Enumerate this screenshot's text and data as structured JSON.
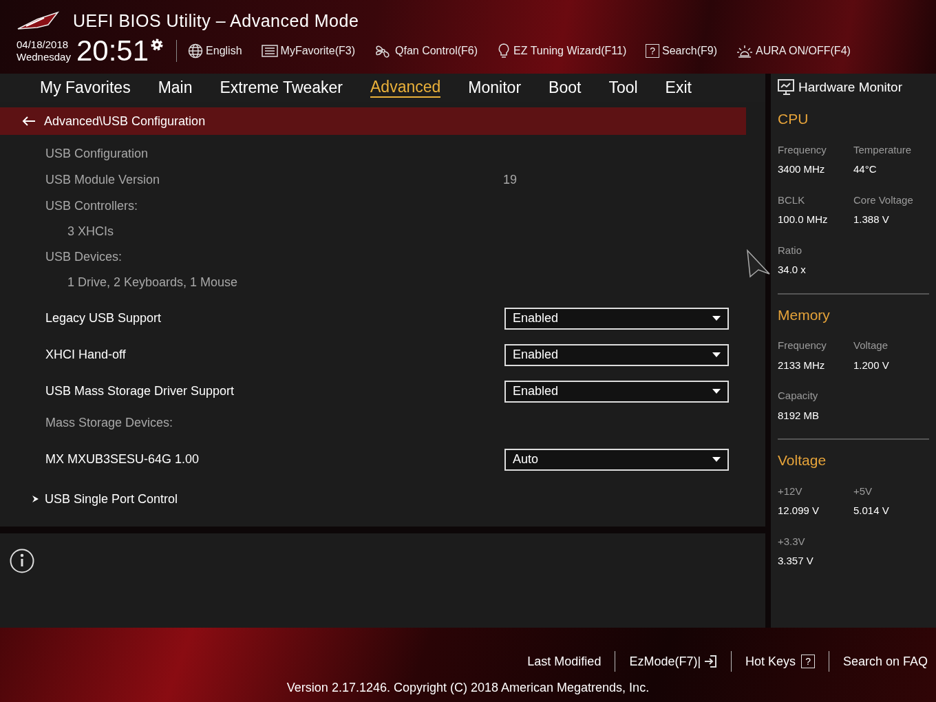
{
  "header": {
    "title": "UEFI BIOS Utility – Advanced Mode",
    "date": "04/18/2018",
    "day": "Wednesday",
    "time": "20:51",
    "tools": [
      {
        "kind": "globe",
        "label": "English"
      },
      {
        "kind": "favorites",
        "label": "MyFavorite(F3)"
      },
      {
        "kind": "fan",
        "label": "Qfan Control(F6)"
      },
      {
        "kind": "bulb",
        "label": "EZ Tuning Wizard(F11)"
      },
      {
        "kind": "keybox",
        "key": "?",
        "label": "Search(F9)"
      },
      {
        "kind": "aura",
        "label": "AURA ON/OFF(F4)"
      }
    ]
  },
  "tabs": [
    {
      "label": "My Favorites",
      "selected": false
    },
    {
      "label": "Main",
      "selected": false
    },
    {
      "label": "Extreme Tweaker",
      "selected": false
    },
    {
      "label": "Advanced",
      "selected": true
    },
    {
      "label": "Monitor",
      "selected": false
    },
    {
      "label": "Boot",
      "selected": false
    },
    {
      "label": "Tool",
      "selected": false
    },
    {
      "label": "Exit",
      "selected": false
    }
  ],
  "breadcrumb": "Advanced\\USB Configuration",
  "settings": [
    {
      "kind": "heading",
      "label": "USB Configuration"
    },
    {
      "kind": "info",
      "label": "USB Module Version",
      "value": "19"
    },
    {
      "kind": "heading",
      "label": "USB Controllers:"
    },
    {
      "kind": "sub",
      "label": "3 XHCIs"
    },
    {
      "kind": "heading",
      "label": "USB Devices:"
    },
    {
      "kind": "sub",
      "label": "1 Drive, 2 Keyboards, 1 Mouse"
    },
    {
      "kind": "select",
      "label": "Legacy USB Support",
      "value": "Enabled"
    },
    {
      "kind": "select",
      "label": "XHCI Hand-off",
      "value": "Enabled"
    },
    {
      "kind": "select",
      "label": "USB Mass Storage Driver Support",
      "value": "Enabled"
    },
    {
      "kind": "heading",
      "label": "Mass Storage Devices:"
    },
    {
      "kind": "select",
      "label": "MX MXUB3SESU-64G 1.00",
      "value": "Auto"
    },
    {
      "kind": "submenu",
      "label": "USB Single Port Control"
    }
  ],
  "hardware_monitor": {
    "title": "Hardware Monitor",
    "sections": [
      {
        "title": "CPU",
        "items": [
          {
            "label": "Frequency",
            "value": "3400 MHz"
          },
          {
            "label": "Temperature",
            "value": "44°C"
          },
          {
            "label": "BCLK",
            "value": "100.0 MHz"
          },
          {
            "label": "Core Voltage",
            "value": "1.388 V"
          },
          {
            "label": "Ratio",
            "value": "34.0 x"
          }
        ]
      },
      {
        "title": "Memory",
        "items": [
          {
            "label": "Frequency",
            "value": "2133 MHz"
          },
          {
            "label": "Voltage",
            "value": "1.200 V"
          },
          {
            "label": "Capacity",
            "value": "8192 MB"
          }
        ]
      },
      {
        "title": "Voltage",
        "items": [
          {
            "label": "+12V",
            "value": "12.099 V"
          },
          {
            "label": "+5V",
            "value": "5.014 V"
          },
          {
            "label": "+3.3V",
            "value": "3.357 V"
          }
        ]
      }
    ]
  },
  "footer": {
    "links": [
      {
        "kind": "plain",
        "label": "Last Modified"
      },
      {
        "kind": "exit",
        "label": "EzMode(F7)|"
      },
      {
        "kind": "keybox",
        "label": "Hot Keys",
        "key": "?"
      },
      {
        "kind": "plain",
        "label": "Search on FAQ"
      }
    ],
    "version": "Version 2.17.1246. Copyright (C) 2018 American Megatrends, Inc."
  }
}
